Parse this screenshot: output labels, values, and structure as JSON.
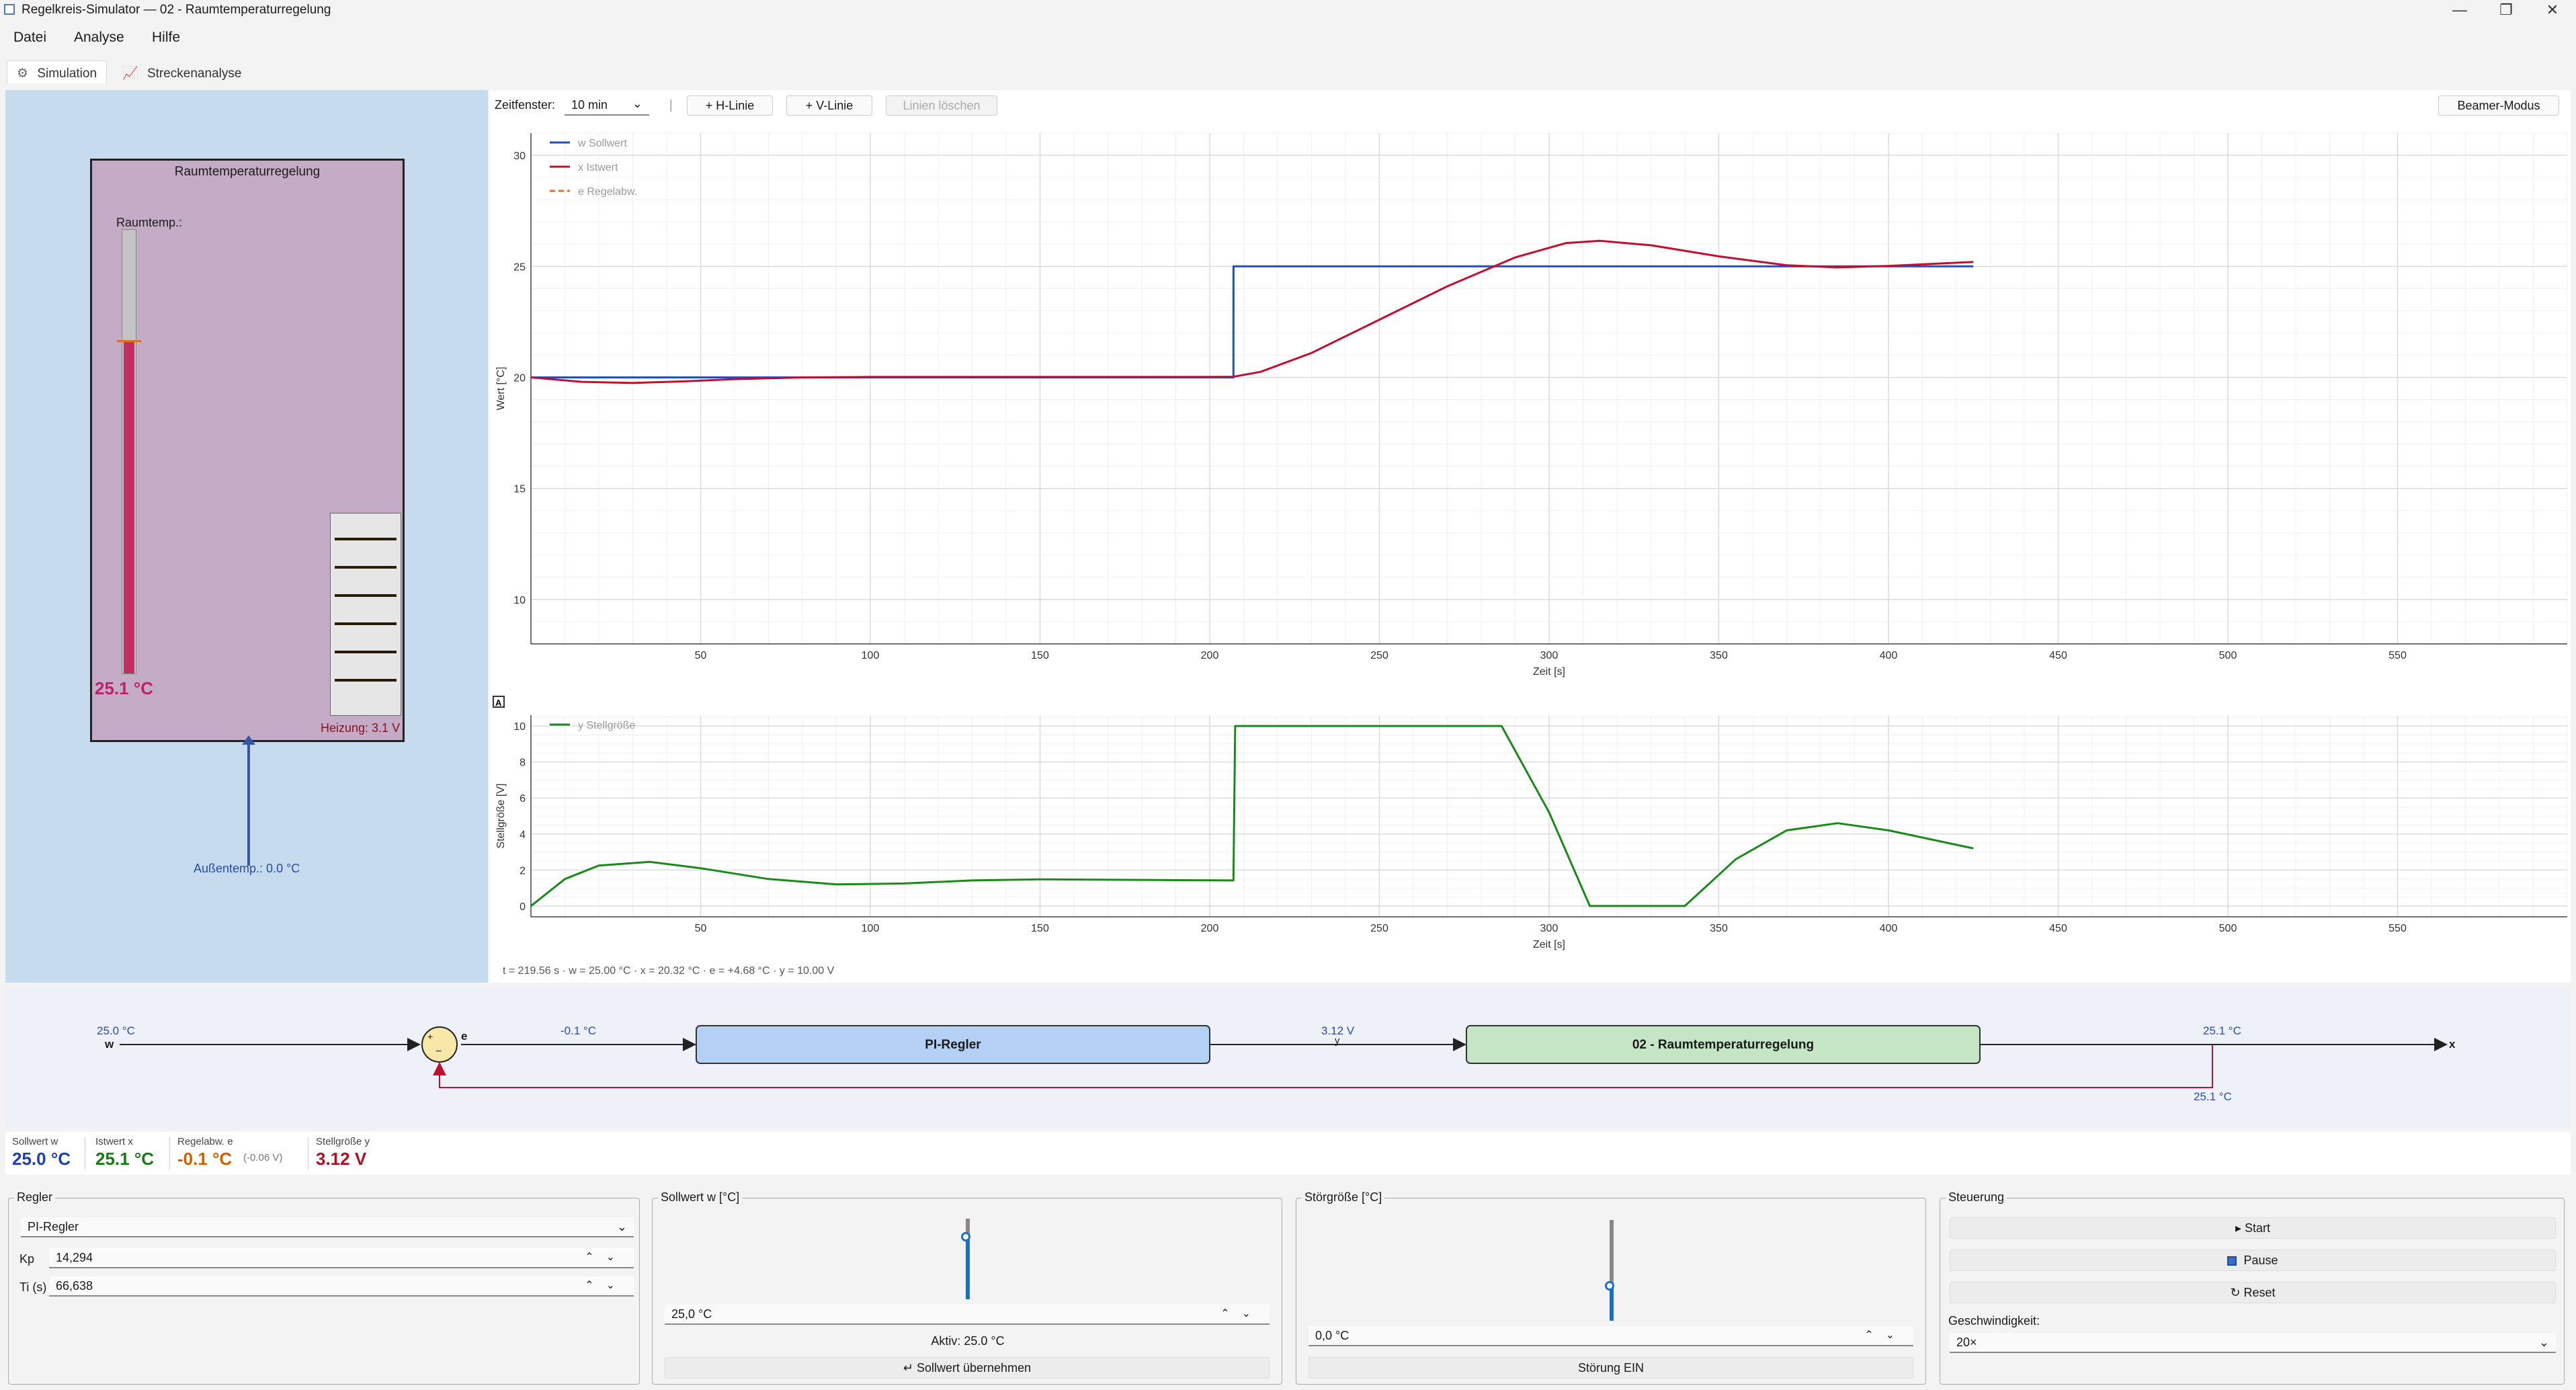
{
  "window": {
    "title": "Regelkreis-Simulator — 02 - Raumtemperaturregelung",
    "min_icon": "minimize-icon",
    "max_icon": "restore-icon",
    "close_icon": "close-icon"
  },
  "menu": [
    "Datei",
    "Analyse",
    "Hilfe"
  ],
  "tabs": [
    {
      "label": "Simulation",
      "icon": "sim-icon",
      "active": true
    },
    {
      "label": "Streckenanalyse",
      "icon": "chart-icon",
      "active": false
    }
  ],
  "room": {
    "title": "Raumtemperaturregelung",
    "temp_label": "Raumtemp.:",
    "temp_value": "25.1 °C",
    "thermo_fraction": 0.75,
    "thermo_marker_fraction": 0.75,
    "heater_label": "Heizung: 3.1 V",
    "outside_label": "Außentemp.: 0.0 °C"
  },
  "toolbar": {
    "zeitfenster_label": "Zeitfenster:",
    "zeitfenster_value": "10 min",
    "separator": "|",
    "h_line": "+ H-Linie",
    "v_line": "+ V-Linie",
    "clear_lines": "Linien löschen",
    "beamer": "Beamer-Modus"
  },
  "colors": {
    "sollwert": "#1f4fc0",
    "istwert": "#c01030",
    "regelabw": "#e07020",
    "stellgroesse": "#1a8a1a"
  },
  "chart_data": [
    {
      "type": "line",
      "ylabel": "Wert [°C]",
      "xlabel": "Zeit [s]",
      "xlim": [
        0,
        600
      ],
      "ylim": [
        8,
        31
      ],
      "xticks": [
        50,
        100,
        150,
        200,
        250,
        300,
        350,
        400,
        450,
        500,
        550
      ],
      "yticks": [
        10,
        15,
        20,
        25,
        30
      ],
      "legend_position": "top-left",
      "grid": true,
      "series": [
        {
          "name": "w Sollwert",
          "color": "#1f4fc0",
          "dashed": false,
          "x": [
            0,
            207,
            207.01,
            425
          ],
          "y": [
            20,
            20,
            25,
            25
          ]
        },
        {
          "name": "x Istwert",
          "color": "#c01030",
          "dashed": false,
          "x": [
            0,
            15,
            30,
            45,
            60,
            80,
            100,
            150,
            200,
            207,
            215,
            230,
            250,
            270,
            290,
            305,
            315,
            330,
            350,
            370,
            385,
            400,
            425
          ],
          "y": [
            20,
            19.8,
            19.75,
            19.82,
            19.92,
            20.0,
            20.02,
            20.02,
            20.02,
            20.03,
            20.25,
            21.1,
            22.6,
            24.1,
            25.4,
            26.05,
            26.15,
            25.95,
            25.45,
            25.05,
            24.95,
            25.02,
            25.2
          ]
        },
        {
          "name": "e Regelabw.",
          "color": "#e07020",
          "dashed": true,
          "x": [],
          "y": []
        }
      ]
    },
    {
      "type": "line",
      "ylabel": "Stellgröße [V]",
      "xlabel": "Zeit [s]",
      "xlim": [
        0,
        600
      ],
      "ylim": [
        -0.6,
        10.6
      ],
      "xticks": [
        50,
        100,
        150,
        200,
        250,
        300,
        350,
        400,
        450,
        500,
        550
      ],
      "yticks": [
        0,
        2,
        4,
        6,
        8,
        10
      ],
      "legend_position": "top-left",
      "grid": true,
      "series": [
        {
          "name": "y Stellgröße",
          "color": "#1a8a1a",
          "dashed": false,
          "x": [
            0,
            10,
            20,
            35,
            50,
            70,
            90,
            110,
            130,
            150,
            180,
            207,
            207.5,
            230,
            260,
            286,
            300,
            312,
            325,
            340,
            355,
            370,
            385,
            400,
            425
          ],
          "y": [
            0,
            1.5,
            2.25,
            2.45,
            2.1,
            1.5,
            1.2,
            1.25,
            1.42,
            1.48,
            1.45,
            1.42,
            10,
            10,
            10,
            10,
            5.2,
            0,
            0,
            0,
            2.6,
            4.2,
            4.6,
            4.2,
            3.2
          ]
        }
      ]
    }
  ],
  "status": "t = 219.56 s  ·  w = 25.00 °C  ·  x = 20.32 °C  ·  e = +4.68 °C  ·  y = 10.00 V",
  "diagram": {
    "w_value": "25.0 °C",
    "w_label": "w",
    "e_label": "e",
    "e_value": "-0.1 °C",
    "controller": "PI-Regler",
    "y_value": "3.12 V",
    "y_label": "y",
    "plant": "02 - Raumtemperaturregelung",
    "x_value_top": "25.1 °C",
    "x_value_bottom": "25.1 °C",
    "x_label": "x",
    "sum_plus": "+",
    "sum_minus": "−"
  },
  "readout": {
    "sollwert_label": "Sollwert w",
    "sollwert_value": "25.0 °C",
    "istwert_label": "Istwert x",
    "istwert_value": "25.1 °C",
    "regelabw_label": "Regelabw. e",
    "regelabw_value": "-0.1 °C",
    "regelabw_extra": "(-0.06 V)",
    "stell_label": "Stellgröße y",
    "stell_value": "3.12 V"
  },
  "regler": {
    "legend": "Regler",
    "type": "PI-Regler",
    "kp_label": "Kp",
    "kp_value": "14,294",
    "ti_label": "Ti (s)",
    "ti_value": "66,638"
  },
  "sollwert_group": {
    "legend": "Sollwert w [°C]",
    "value": "25,0 °C",
    "slider_fraction": 0.75,
    "active": "Aktiv: 25.0 °C",
    "apply": "↵ Sollwert übernehmen"
  },
  "stoer_group": {
    "legend": "Störgröße [°C]",
    "value": "0,0 °C",
    "slider_fraction": 0.33,
    "toggle": "Störung EIN"
  },
  "steuerung": {
    "legend": "Steuerung",
    "start": "▸ Start",
    "pause": "Pause",
    "reset": "↻ Reset",
    "speed_label": "Geschwindigkeit:",
    "speed_value": "20×"
  }
}
